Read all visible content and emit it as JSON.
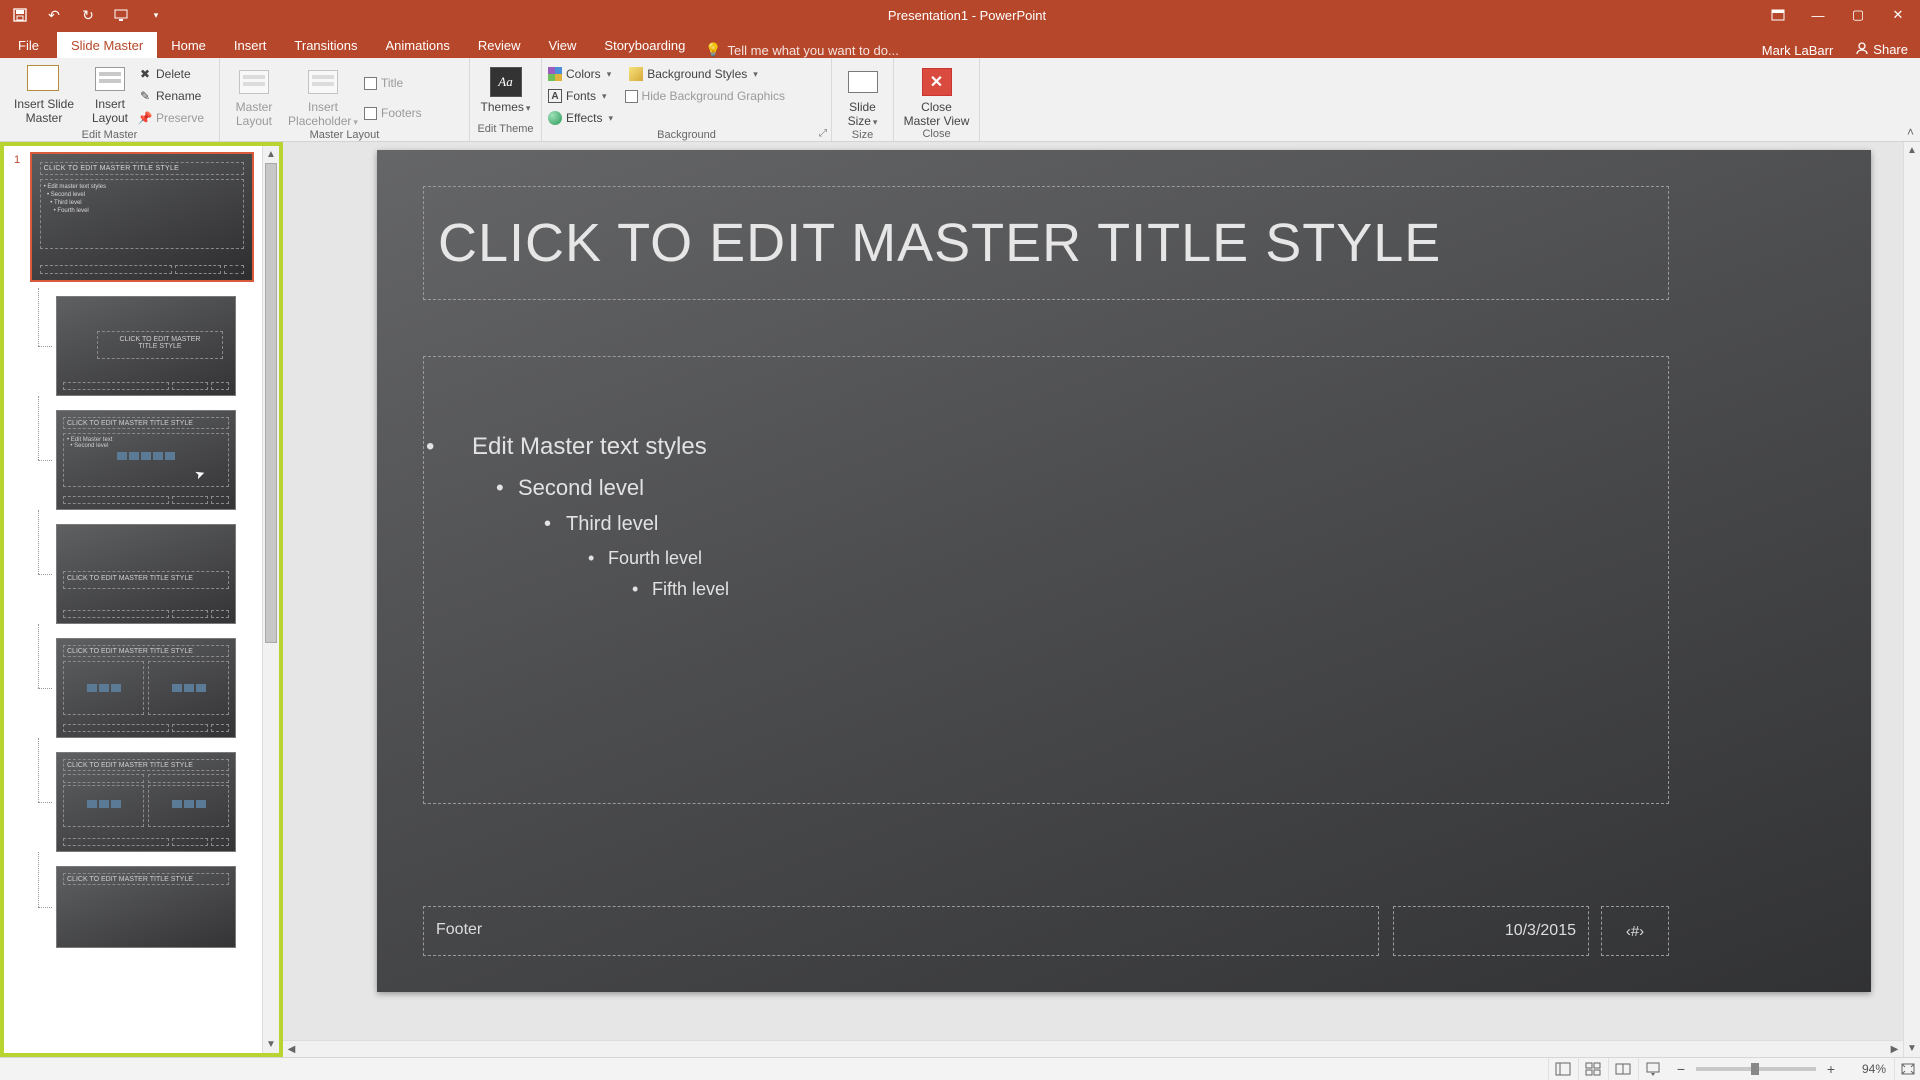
{
  "app": {
    "title": "Presentation1 - PowerPoint",
    "user": "Mark LaBarr",
    "share": "Share"
  },
  "tabs": {
    "file": "File",
    "list": [
      "Slide Master",
      "Home",
      "Insert",
      "Transitions",
      "Animations",
      "Review",
      "View",
      "Storyboarding"
    ],
    "activeIndex": 0,
    "tellme_placeholder": "Tell me what you want to do..."
  },
  "ribbon": {
    "editMaster": {
      "insertSlideMaster": "Insert Slide\nMaster",
      "insertLayout": "Insert\nLayout",
      "delete": "Delete",
      "rename": "Rename",
      "preserve": "Preserve",
      "group": "Edit Master"
    },
    "masterLayout": {
      "masterLayout": "Master\nLayout",
      "insertPlaceholder": "Insert\nPlaceholder",
      "title": "Title",
      "footers": "Footers",
      "group": "Master Layout"
    },
    "editTheme": {
      "themes": "Themes",
      "group": "Edit Theme"
    },
    "background": {
      "colors": "Colors",
      "fonts": "Fonts",
      "effects": "Effects",
      "bgstyles": "Background Styles",
      "hidebg": "Hide Background Graphics",
      "group": "Background"
    },
    "size": {
      "slideSize": "Slide\nSize",
      "group": "Size"
    },
    "close": {
      "close": "Close\nMaster View",
      "group": "Close"
    }
  },
  "thumbs": {
    "masterNumber": "1",
    "masterTitle": "CLICK TO EDIT MASTER TITLE STYLE",
    "layoutTitleText": "CLICK TO EDIT MASTER\nTITLE STYLE",
    "layoutTitleSingle": "CLICK TO EDIT MASTER TITLE STYLE"
  },
  "slide": {
    "title": "CLICK TO EDIT MASTER TITLE STYLE",
    "lvl1": "Edit Master text styles",
    "lvl2": "Second level",
    "lvl3": "Third level",
    "lvl4": "Fourth level",
    "lvl5": "Fifth level",
    "footer": "Footer",
    "date": "10/3/2015",
    "num": "‹#›"
  },
  "status": {
    "left": "",
    "zoom": "94%"
  }
}
